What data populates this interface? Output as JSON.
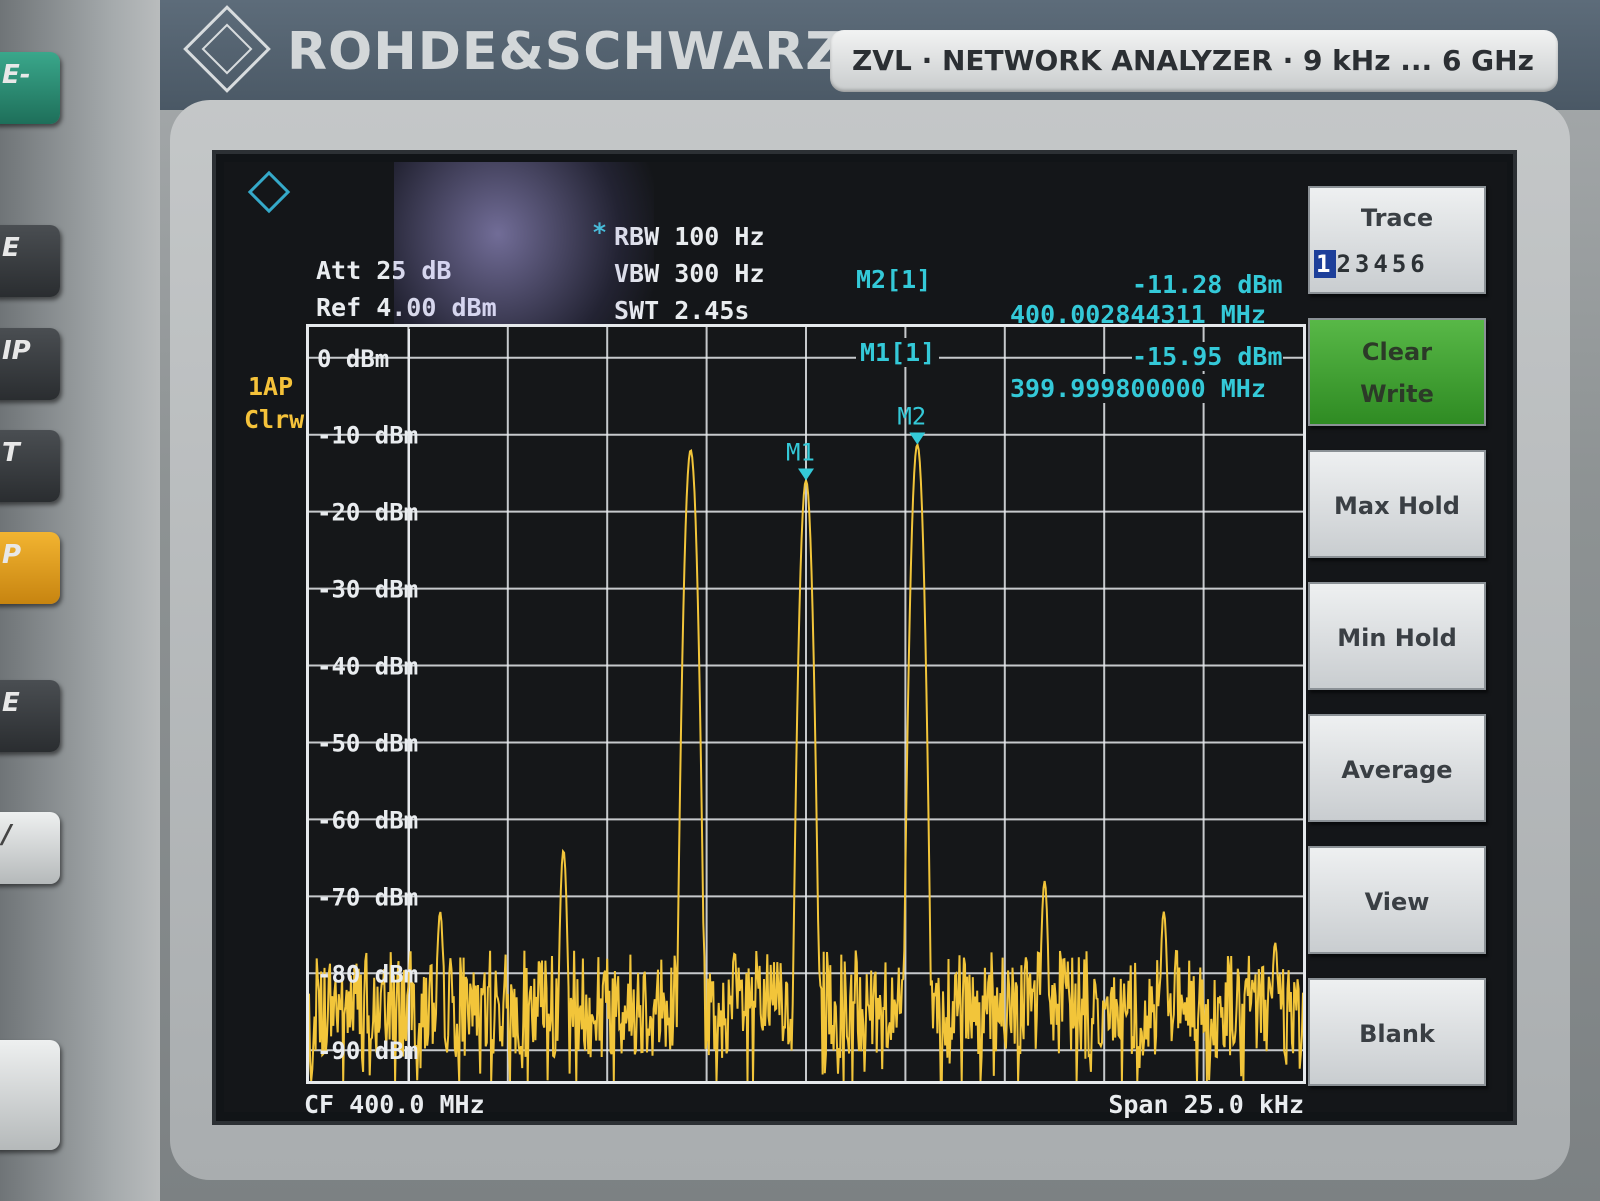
{
  "brand": {
    "name": "ROHDE&SCHWARZ"
  },
  "model_plate": {
    "text": "ZVL · NETWORK ANALYZER · 9 kHz ... 6 GHz"
  },
  "left_keys": [
    "E-",
    "E",
    "IP",
    "T",
    "P",
    "E",
    "/"
  ],
  "settings": {
    "rbw_marker": "*",
    "rbw": "RBW 100 Hz",
    "vbw": "VBW 300 Hz",
    "swt": "SWT 2.45s",
    "att": "Att  25 dB",
    "ref": "Ref  4.00 dBm"
  },
  "trace_label": {
    "line1": "1AP",
    "line2": "Clrw"
  },
  "markers": [
    {
      "id": "M2[1]",
      "level": "-11.28 dBm",
      "freq": "400.002844311 MHz"
    },
    {
      "id": "M1[1]",
      "level": "-15.95 dBm",
      "freq": "399.999800000 MHz"
    }
  ],
  "marker_flags": {
    "m1": "M1",
    "m2": "M2"
  },
  "bottom": {
    "cf": "CF  400.0 MHz",
    "span": "Span 25.0 kHz"
  },
  "softkeys": {
    "trace": {
      "label": "Trace",
      "digits": [
        "1",
        "2",
        "3",
        "4",
        "5",
        "6"
      ]
    },
    "clear_write_l1": "Clear",
    "clear_write_l2": "Write",
    "max_hold": "Max Hold",
    "min_hold": "Min Hold",
    "average": "Average",
    "view": "View",
    "blank": "Blank"
  },
  "colors": {
    "trace": "#f2c53a",
    "grid": "#e6e9ec",
    "marker": "#34c9d8",
    "active_softkey": "#3f9f31"
  },
  "chart_data": {
    "type": "line",
    "title": "",
    "xlabel": "",
    "ylabel": "",
    "x_range_khz": [
      -12.5,
      12.5
    ],
    "ylim": [
      -94,
      4
    ],
    "y_ticks": [
      "0 dBm",
      "-10 dBm",
      "-20 dBm",
      "-30 dBm",
      "-40 dBm",
      "-50 dBm",
      "-60 dBm",
      "-70 dBm",
      "-80 dBm",
      "-90 dBm"
    ],
    "y_tick_values": [
      0,
      -10,
      -20,
      -30,
      -40,
      -50,
      -60,
      -70,
      -80,
      -90
    ],
    "grid": true,
    "peaks": [
      {
        "offset_khz": -9.2,
        "level_dbm": -72
      },
      {
        "offset_khz": -6.1,
        "level_dbm": -64
      },
      {
        "offset_khz": -2.9,
        "level_dbm": -12
      },
      {
        "offset_khz": 0.0,
        "level_dbm": -15.95
      },
      {
        "offset_khz": 2.8,
        "level_dbm": -11.28
      },
      {
        "offset_khz": 6.0,
        "level_dbm": -68
      },
      {
        "offset_khz": 9.0,
        "level_dbm": -72
      },
      {
        "offset_khz": 11.8,
        "level_dbm": -76
      }
    ],
    "noise_floor_dbm": -84
  }
}
